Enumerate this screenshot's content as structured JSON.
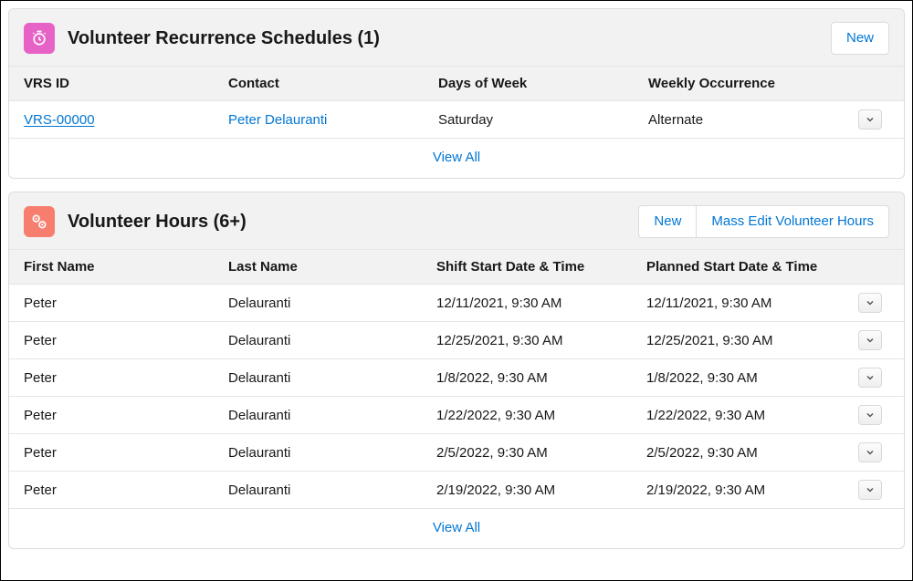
{
  "vrs": {
    "title": "Volunteer Recurrence Schedules (1)",
    "new_label": "New",
    "columns": {
      "id": "VRS ID",
      "contact": "Contact",
      "days": "Days of Week",
      "weekly": "Weekly Occurrence"
    },
    "rows": [
      {
        "id": "VRS-00000",
        "contact": "Peter Delauranti",
        "days": "Saturday",
        "weekly": "Alternate"
      }
    ],
    "view_all": "View All"
  },
  "hours": {
    "title": "Volunteer Hours (6+)",
    "new_label": "New",
    "mass_edit_label": "Mass Edit Volunteer Hours",
    "columns": {
      "first": "First Name",
      "last": "Last Name",
      "shift": "Shift Start Date & Time",
      "planned": "Planned Start Date & Time"
    },
    "rows": [
      {
        "first": "Peter",
        "last": "Delauranti",
        "shift": "12/11/2021, 9:30 AM",
        "planned": "12/11/2021, 9:30 AM"
      },
      {
        "first": "Peter",
        "last": "Delauranti",
        "shift": "12/25/2021, 9:30 AM",
        "planned": "12/25/2021, 9:30 AM"
      },
      {
        "first": "Peter",
        "last": "Delauranti",
        "shift": "1/8/2022, 9:30 AM",
        "planned": "1/8/2022, 9:30 AM"
      },
      {
        "first": "Peter",
        "last": "Delauranti",
        "shift": "1/22/2022, 9:30 AM",
        "planned": "1/22/2022, 9:30 AM"
      },
      {
        "first": "Peter",
        "last": "Delauranti",
        "shift": "2/5/2022, 9:30 AM",
        "planned": "2/5/2022, 9:30 AM"
      },
      {
        "first": "Peter",
        "last": "Delauranti",
        "shift": "2/19/2022, 9:30 AM",
        "planned": "2/19/2022, 9:30 AM"
      }
    ],
    "view_all": "View All"
  }
}
